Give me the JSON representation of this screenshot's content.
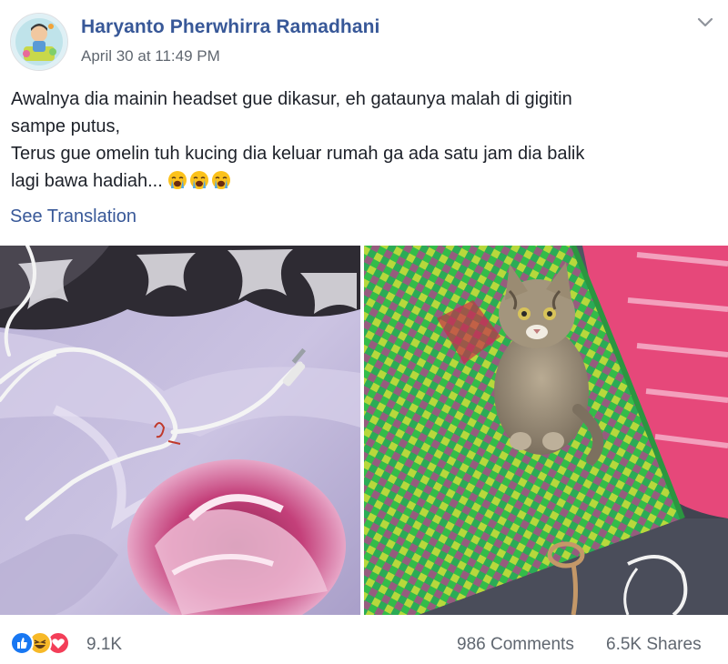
{
  "post": {
    "author": "Haryanto Pherwhirra Ramadhani",
    "timestamp": "April 30 at 11:49 PM",
    "text_lines": [
      "Awalnya dia mainin headset gue dikasur, eh gataunya malah di gigitin",
      "sampe putus,",
      "Terus gue omelin tuh kucing dia keluar rumah ga ada satu jam dia balik",
      "lagi bawa hadiah..."
    ],
    "emojis": [
      "loudly-crying-face-icon",
      "loudly-crying-face-icon",
      "loudly-crying-face-icon"
    ],
    "see_translation": "See Translation",
    "menu_icon": "chevron-down-icon"
  },
  "photos": [
    {
      "subject": "white earphone cable bitten and broken on a purple floral bedsheet"
    },
    {
      "subject": "tabby cat sitting on a green woven mat beside a cable loop"
    }
  ],
  "footer": {
    "reaction_icons": [
      "like-icon",
      "haha-icon",
      "love-icon"
    ],
    "reaction_count": "9.1K",
    "comments": "986 Comments",
    "shares": "6.5K Shares"
  },
  "colors": {
    "link": "#385898",
    "text": "#1d2129",
    "meta": "#606770",
    "like": "#1877f2",
    "haha": "#f7b928",
    "love": "#f33e58"
  }
}
